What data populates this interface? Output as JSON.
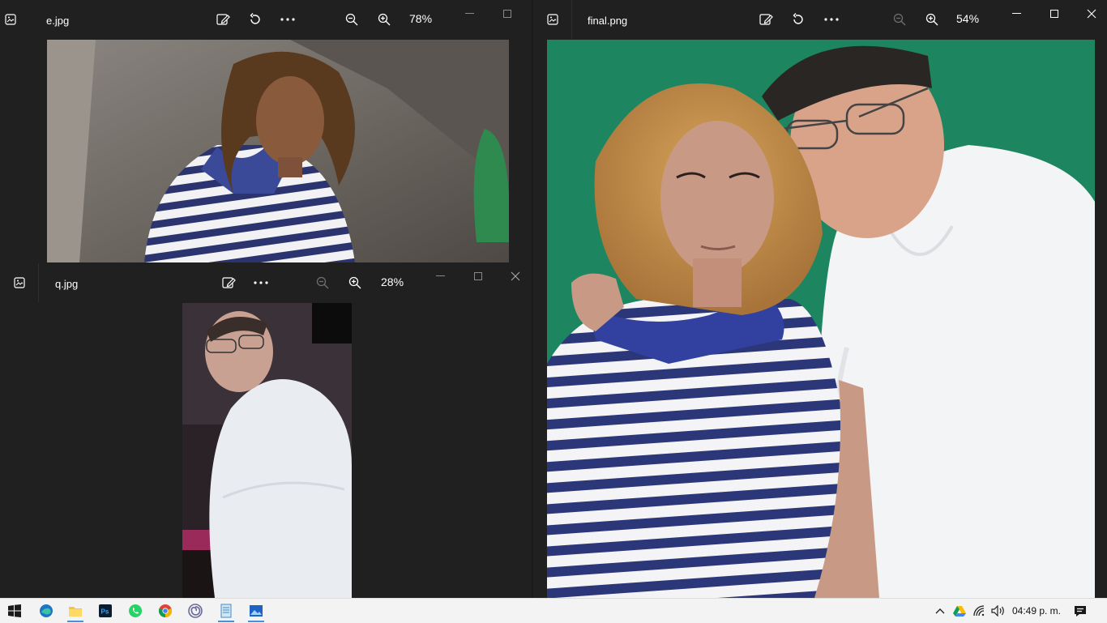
{
  "windows": {
    "e": {
      "filename": "e.jpg",
      "zoom": "78%"
    },
    "final": {
      "filename": "final.png",
      "zoom": "54%"
    },
    "q": {
      "filename": "q.jpg",
      "zoom": "28%"
    }
  },
  "taskbar": {
    "apps": [
      {
        "name": "windows-start-icon"
      },
      {
        "name": "edge-browser-icon"
      },
      {
        "name": "file-explorer-icon"
      },
      {
        "name": "photoshop-icon"
      },
      {
        "name": "whatsapp-icon"
      },
      {
        "name": "chrome-icon"
      },
      {
        "name": "app-spiral-icon"
      },
      {
        "name": "notepad-icon"
      },
      {
        "name": "photos-app-icon"
      }
    ],
    "clock": "04:49 p. m."
  },
  "colors": {
    "app_bg": "#202020",
    "final_bg": "#1d8660",
    "taskbar_bg": "#f3f3f3"
  }
}
